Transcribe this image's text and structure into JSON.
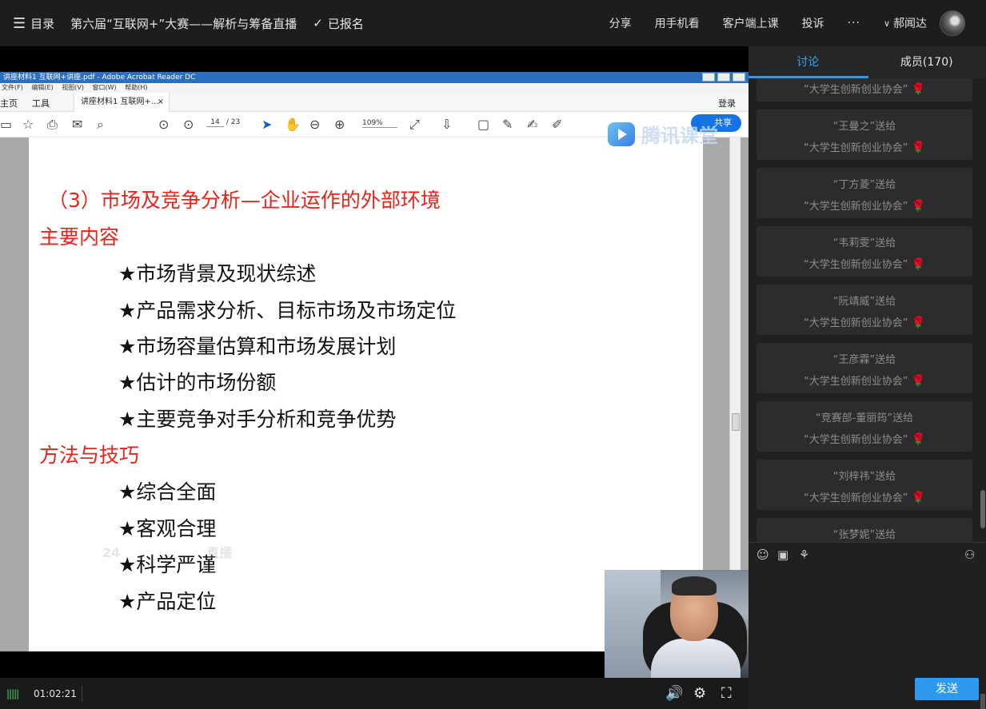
{
  "topbar": {
    "menu_label": "目录",
    "course_title": "第六届“互联网+”大赛——解析与筹备直播",
    "registered_label": "已报名",
    "actions": [
      "分享",
      "用手机看",
      "客户端上课",
      "投诉"
    ],
    "more": "···",
    "user_name": "郝闻达"
  },
  "acrobat": {
    "window_title": "讲座材料1 互联网+讲座.pdf - Adobe Acrobat Reader DC",
    "menu": [
      "文件(F)",
      "编辑(E)",
      "视图(V)",
      "窗口(W)",
      "帮助(H)"
    ],
    "tab_home": "主页",
    "tab_tools": "工具",
    "doc_tab": "讲座材料1 互联网+...",
    "login": "登录",
    "page_current": "14",
    "page_total": "/ 23",
    "zoom": "109%",
    "share_label": "共享"
  },
  "slide": {
    "heading": "（3）市场及竞争分析—企业运作的外部环境",
    "section1": "主要内容",
    "items1": [
      "★市场背景及现状综述",
      "★产品需求分析、目标市场及市场定位",
      "★市场容量估算和市场发展计划",
      "★估计的市场份额",
      "★主要竞争对手分析和竞争优势"
    ],
    "section2": "方法与技巧",
    "items2": [
      "★综合全面",
      "★客观合理",
      "★科学严谨",
      "★产品定位"
    ]
  },
  "watermark": "腾讯课堂",
  "ghost_text": "24",
  "ghost_text_2": "直播",
  "player": {
    "time": "01:02:21"
  },
  "panel": {
    "tab_discuss": "讨论",
    "tab_members": "成员(170)",
    "messages": [
      {
        "from": "",
        "to": "“大学生创新创业协会”"
      },
      {
        "from": "“王曼之”送给",
        "to": "“大学生创新创业协会”"
      },
      {
        "from": "“丁方菱”送给",
        "to": "“大学生创新创业协会”"
      },
      {
        "from": "“韦莉雯”送给",
        "to": "“大学生创新创业协会”"
      },
      {
        "from": "“阮靖威”送给",
        "to": "“大学生创新创业协会”"
      },
      {
        "from": "“王彦霖”送给",
        "to": "“大学生创新创业协会”"
      },
      {
        "from": "“竞赛部-董丽筠”送给",
        "to": "“大学生创新创业协会”"
      },
      {
        "from": "“刘梓祎”送给",
        "to": "“大学生创新创业协会”"
      },
      {
        "from": "“张梦妮”送给",
        "to": ""
      }
    ],
    "send_label": "发送"
  }
}
